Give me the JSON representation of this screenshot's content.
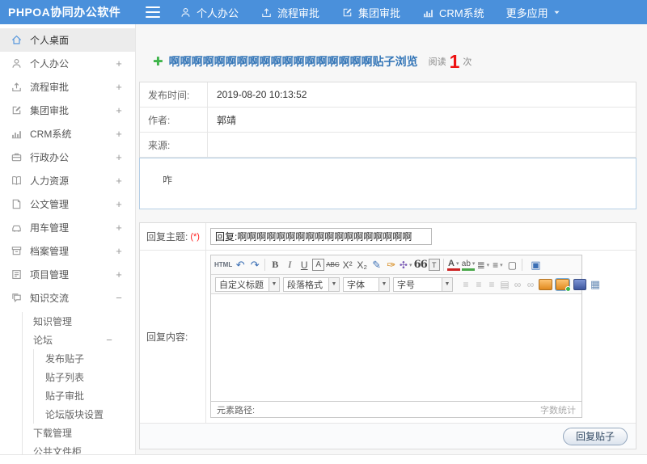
{
  "topbar": {
    "logo": "PHPOA协同办公软件",
    "nav": [
      {
        "label": "个人办公",
        "icon": "user",
        "n": "nav-personal-office"
      },
      {
        "label": "流程审批",
        "icon": "upload",
        "n": "nav-workflow-approval"
      },
      {
        "label": "集团审批",
        "icon": "edit",
        "n": "nav-group-approval"
      },
      {
        "label": "CRM系统",
        "icon": "chart",
        "n": "nav-crm-system"
      },
      {
        "label": "更多应用",
        "trail": "caret",
        "n": "nav-more-apps"
      }
    ]
  },
  "sidebar": {
    "items": [
      {
        "label": "个人桌面",
        "icon": "home",
        "cls": "active",
        "expander": "",
        "n": "sidebar-item-personal-desktop"
      },
      {
        "label": "个人办公",
        "icon": "user",
        "expander": "+",
        "n": "sidebar-item-personal-office"
      },
      {
        "label": "流程审批",
        "icon": "upload",
        "expander": "+",
        "n": "sidebar-item-workflow-approval"
      },
      {
        "label": "集团审批",
        "icon": "edit",
        "expander": "+",
        "n": "sidebar-item-group-approval"
      },
      {
        "label": "CRM系统",
        "icon": "chart",
        "expander": "+",
        "n": "sidebar-item-crm-system"
      },
      {
        "label": "行政办公",
        "icon": "briefcase",
        "expander": "+",
        "n": "sidebar-item-admin-office"
      },
      {
        "label": "人力资源",
        "icon": "book",
        "expander": "+",
        "n": "sidebar-item-hr"
      },
      {
        "label": "公文管理",
        "icon": "doc",
        "expander": "+",
        "n": "sidebar-item-official-docs"
      },
      {
        "label": "用车管理",
        "icon": "car",
        "expander": "+",
        "n": "sidebar-item-vehicle-management"
      },
      {
        "label": "档案管理",
        "icon": "archive",
        "expander": "+",
        "n": "sidebar-item-archive-management"
      },
      {
        "label": "项目管理",
        "icon": "project",
        "expander": "+",
        "n": "sidebar-item-project-management"
      },
      {
        "label": "知识交流",
        "icon": "chat",
        "expander": "−",
        "n": "sidebar-item-knowledge-exchange"
      }
    ],
    "knowledge": {
      "first": "知识管理",
      "forum_label": "论坛",
      "forum_expander": "−",
      "forum_children": [
        "发布贴子",
        "贴子列表",
        "贴子审批",
        "论坛版块设置"
      ],
      "rest": [
        "下载管理",
        "公共文件柜"
      ]
    }
  },
  "main": {
    "title": "啊啊啊啊啊啊啊啊啊啊啊啊啊啊啊啊啊啊贴子浏览",
    "read_label": "阅读",
    "read_count": "1",
    "read_unit": "次",
    "info_rows": [
      {
        "label": "发布时间:",
        "value": "2019-08-20 10:13:52"
      },
      {
        "label": "作者:",
        "value": "郭靖"
      },
      {
        "label": "来源:",
        "value": ""
      }
    ],
    "content_text": "咋",
    "reply_form": {
      "subject_label": "回复主题:",
      "required_mark": "(*)",
      "subject_value": "回复:啊啊啊啊啊啊啊啊啊啊啊啊啊啊啊啊啊啊",
      "content_label": "回复内容:",
      "submit_label": "回复贴子"
    },
    "editor": {
      "toolbar_row1": [
        {
          "g": "HTML",
          "n": "source-code-button",
          "c": "t-html"
        },
        {
          "g": "↶",
          "n": "undo-icon",
          "c": "t-blue"
        },
        {
          "g": "↷",
          "n": "redo-icon",
          "c": "t-blue"
        },
        {
          "g": "",
          "n": "toolbar-separator",
          "c": "t-sep"
        },
        {
          "g": "B",
          "n": "bold-button",
          "c": "t-bold"
        },
        {
          "g": "I",
          "n": "italic-button",
          "c": "t-italic"
        },
        {
          "g": "U",
          "n": "underline-button",
          "c": "t-underline"
        },
        {
          "g": "A",
          "n": "bordered-text-button",
          "c": "t-boxA"
        },
        {
          "g": "ABC",
          "n": "strikethrough-button",
          "c": "t-abc"
        },
        {
          "g": "X²",
          "n": "superscript-button",
          "c": ""
        },
        {
          "g": "X₂",
          "n": "subscript-button",
          "c": ""
        },
        {
          "g": "✎",
          "n": "eraser-icon",
          "c": "t-blue"
        },
        {
          "g": "✑",
          "n": "format-painter-icon",
          "c": "t-orange"
        },
        {
          "g": "✣",
          "n": "auto-typeset-icon",
          "c": "t-purple t-caret"
        },
        {
          "g": "66",
          "n": "blockquote-button",
          "c": "t-quote"
        },
        {
          "g": "T",
          "n": "paste-plain-button",
          "c": "t-boxT"
        },
        {
          "g": "",
          "n": "toolbar-separator",
          "c": "t-sep"
        },
        {
          "g": "A",
          "n": "font-color-button",
          "c": "t-fontcolor t-caret"
        },
        {
          "g": "ab",
          "n": "highlight-color-button",
          "c": "t-hicolor t-caret"
        },
        {
          "g": "≣",
          "n": "ordered-list-button",
          "c": "t-caret"
        },
        {
          "g": "≡",
          "n": "unordered-list-button",
          "c": "t-caret"
        },
        {
          "g": "▢",
          "n": "blank-doc-button",
          "c": ""
        },
        {
          "g": "",
          "n": "toolbar-separator",
          "c": "t-sep"
        },
        {
          "g": "▣",
          "n": "fullscreen-button",
          "c": "t-fullscreen"
        }
      ],
      "toolbar_selects": [
        {
          "label": "自定义标题",
          "n": "custom-title-select"
        },
        {
          "label": "段落格式",
          "n": "paragraph-format-select"
        },
        {
          "label": "字体",
          "n": "font-family-select"
        },
        {
          "label": "字号",
          "n": "font-size-select"
        }
      ],
      "toolbar_row2_icons": [
        {
          "g": "≡",
          "n": "align-left-icon",
          "c": "t-mut"
        },
        {
          "g": "≡",
          "n": "align-center-icon",
          "c": "t-mut"
        },
        {
          "g": "≡",
          "n": "align-right-icon",
          "c": "t-mut"
        },
        {
          "g": "▤",
          "n": "justify-icon",
          "c": "t-mut"
        },
        {
          "g": "∞",
          "n": "link-icon",
          "c": "t-mut"
        },
        {
          "g": "∞",
          "n": "unlink-icon",
          "c": "t-mut"
        },
        {
          "g": "",
          "n": "insert-image-icon",
          "c": "t-img"
        },
        {
          "g": "",
          "n": "image-manager-icon",
          "c": "t-img t-img-hl"
        },
        {
          "g": "",
          "n": "insert-video-icon",
          "c": "t-vid"
        },
        {
          "g": "▦",
          "n": "insert-table-icon",
          "c": "t-tbl"
        }
      ],
      "statusbar_left": "元素路径:",
      "statusbar_right": "字数统计"
    }
  },
  "colors": {
    "topbar_blue": "#4a90db",
    "title_blue": "#3677b8",
    "read_count_red": "#ee1111",
    "add_green": "#3fb44a",
    "content_border_blue": "#b5cfe6"
  }
}
